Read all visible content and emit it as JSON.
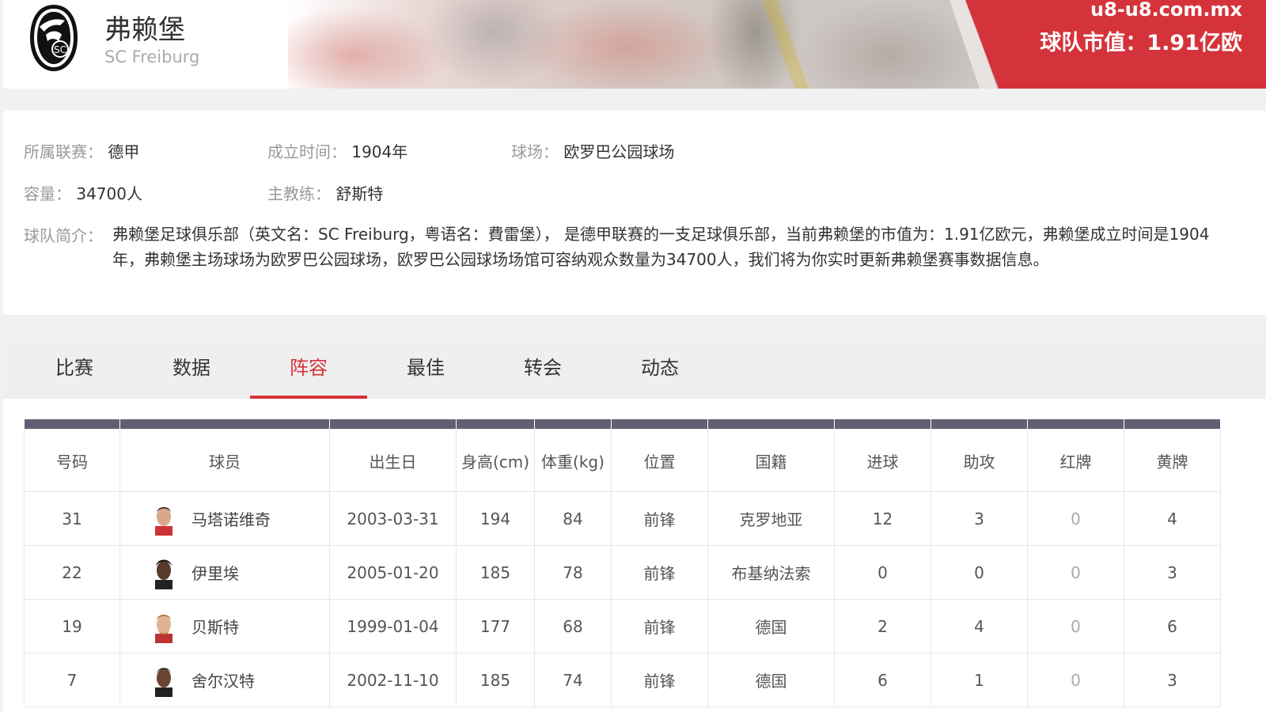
{
  "header": {
    "team_name_cn": "弗赖堡",
    "team_name_en": "SC Freiburg",
    "site": "u8-u8.com.mx",
    "market_value": "球队市值：1.91亿欧"
  },
  "info": {
    "league_label": "所属联赛：",
    "league_value": "德甲",
    "founded_label": "成立时间：",
    "founded_value": "1904年",
    "stadium_label": "球场：",
    "stadium_value": "欧罗巴公园球场",
    "capacity_label": "容量：",
    "capacity_value": "34700人",
    "coach_label": "主教练：",
    "coach_value": "舒斯特",
    "desc_label": "球队简介：",
    "desc_text": "弗赖堡足球俱乐部（英文名：SC Freiburg，粤语名：費雷堡）， 是德甲联赛的一支足球俱乐部，当前弗赖堡的市值为：1.91亿欧元，弗赖堡成立时间是1904年，弗赖堡主场球场为欧罗巴公园球场，欧罗巴公园球场场馆可容纳观众数量为34700人，我们将为你实时更新弗赖堡赛事数据信息。"
  },
  "tabs": [
    {
      "label": "比赛"
    },
    {
      "label": "数据"
    },
    {
      "label": "阵容",
      "active": true
    },
    {
      "label": "最佳"
    },
    {
      "label": "转会"
    },
    {
      "label": "动态"
    }
  ],
  "table": {
    "columns": [
      "号码",
      "球员",
      "出生日",
      "身高(cm)",
      "体重(kg)",
      "位置",
      "国籍",
      "进球",
      "助攻",
      "红牌",
      "黄牌"
    ],
    "rows": [
      {
        "number": "31",
        "name": "马塔诺维奇",
        "birth": "2003-03-31",
        "height": "194",
        "weight": "84",
        "position": "前锋",
        "nation": "克罗地亚",
        "goals": "12",
        "assists": "3",
        "red": "0",
        "yellow": "4"
      },
      {
        "number": "22",
        "name": "伊里埃",
        "birth": "2005-01-20",
        "height": "185",
        "weight": "78",
        "position": "前锋",
        "nation": "布基纳法索",
        "goals": "0",
        "assists": "0",
        "red": "0",
        "yellow": "3"
      },
      {
        "number": "19",
        "name": "贝斯特",
        "birth": "1999-01-04",
        "height": "177",
        "weight": "68",
        "position": "前锋",
        "nation": "德国",
        "goals": "2",
        "assists": "4",
        "red": "0",
        "yellow": "6"
      },
      {
        "number": "7",
        "name": "舍尔汉特",
        "birth": "2002-11-10",
        "height": "185",
        "weight": "74",
        "position": "前锋",
        "nation": "德国",
        "goals": "6",
        "assists": "1",
        "red": "0",
        "yellow": "3"
      }
    ]
  },
  "colors": {
    "accent": "#d5333b",
    "table_header_bar": "#5f6073"
  }
}
